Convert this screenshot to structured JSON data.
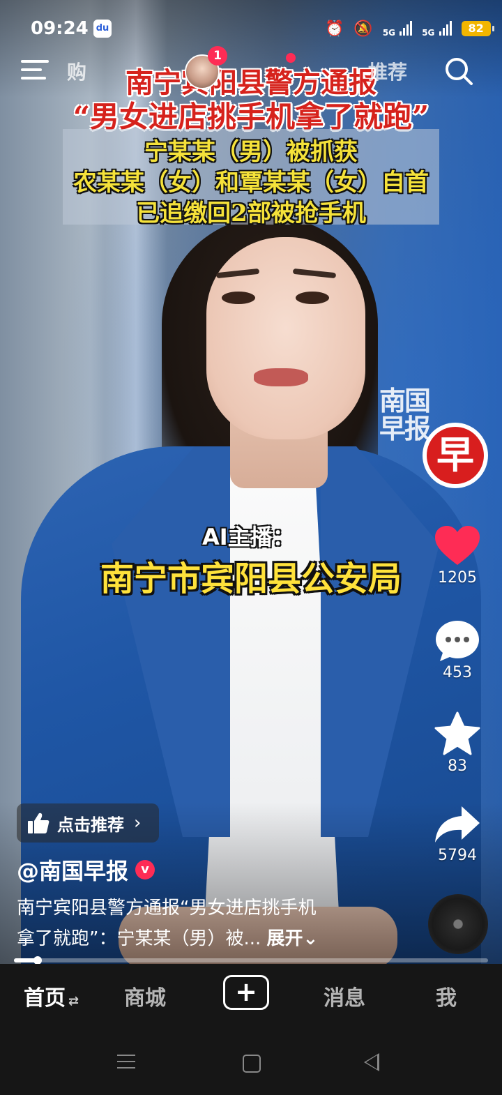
{
  "status_bar": {
    "time": "09:24",
    "app_icon": "baidu-icon",
    "network1": "5G",
    "network2": "5G",
    "battery": "82"
  },
  "top_nav": {
    "tabs": [
      {
        "label": "购"
      },
      {
        "label": "推荐"
      }
    ],
    "notification_badge": "1"
  },
  "video": {
    "headline_line1": "南宁宾阳县警方通报",
    "headline_line2": "“男女进店挑手机拿了就跑”",
    "info_lines": [
      "宁某某（男）被抓获",
      "农某某（女）和覃某某（女）自首",
      "已追缴回2部被抢手机"
    ],
    "watermark_text": "南国早报",
    "watermark_logo_char": "早",
    "ai_label": "AI主播：",
    "subtitle": "南宁市宾阳县公安局"
  },
  "actions": {
    "likes": "1205",
    "comments": "453",
    "favorites": "83",
    "shares": "5794"
  },
  "overlay": {
    "recommend_label": "点击推荐",
    "author": "@南国早报",
    "verified_mark": "v",
    "caption_line1": "南宁宾阳县警方通报“男女进店挑手机",
    "caption_line2": "拿了就跑”：宁某某（男）被...",
    "caption_more": "展开",
    "progress_fraction": 0.05
  },
  "tab_bar": {
    "home": "首页",
    "mall": "商城",
    "add": "+",
    "messages": "消息",
    "me": "我"
  },
  "colors": {
    "accent_red": "#fe2c55",
    "headline_red": "#d6221c",
    "subtitle_yellow": "#ffe23b",
    "battery": "#f2b500"
  }
}
